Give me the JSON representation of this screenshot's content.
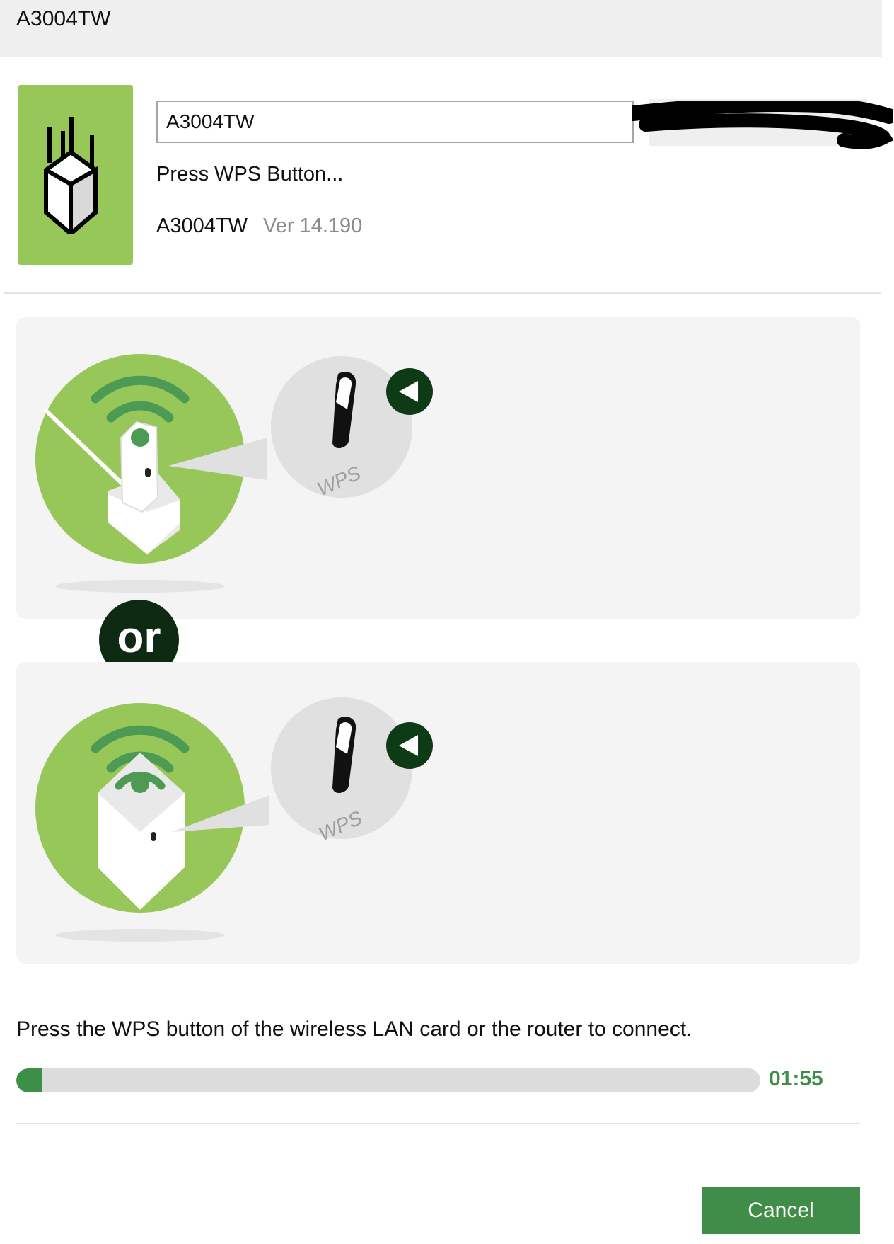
{
  "window": {
    "title": "A3004TW"
  },
  "device": {
    "name_value": "A3004TW",
    "status": "Press WPS Button...",
    "model": "A3004TW",
    "version": "Ver 14.190"
  },
  "illustrations": {
    "button_label": "WPS",
    "separator": "or"
  },
  "instruction": "Press the WPS button of the wireless LAN card or the router to connect.",
  "progress": {
    "fraction": 0.035,
    "time_left": "01:55"
  },
  "buttons": {
    "cancel": "Cancel"
  },
  "colors": {
    "green": "#97c659",
    "dark_green": "#0e2a12",
    "accent": "#3c8f47"
  }
}
